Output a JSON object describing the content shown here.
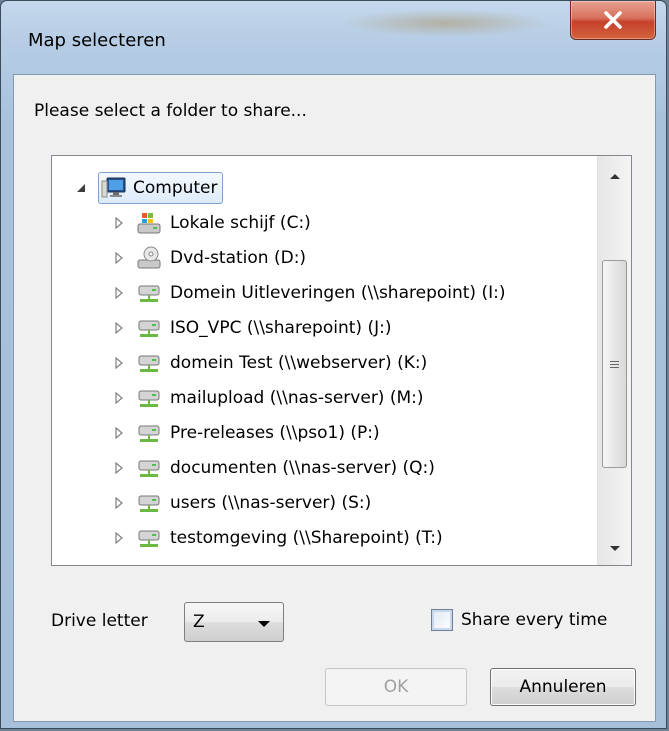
{
  "window": {
    "title": "Map selecteren",
    "close_icon": "close-icon"
  },
  "dialog": {
    "prompt": "Please select a folder to share...",
    "tree": {
      "root": {
        "label": "Computer",
        "icon": "computer-icon",
        "expanded": true
      },
      "children": [
        {
          "label": "Lokale schijf (C:)",
          "icon": "local-disk-icon"
        },
        {
          "label": "Dvd-station (D:)",
          "icon": "dvd-drive-icon"
        },
        {
          "label": "Domein Uitleveringen (\\\\sharepoint) (I:)",
          "icon": "network-drive-icon"
        },
        {
          "label": "ISO_VPC (\\\\sharepoint) (J:)",
          "icon": "network-drive-icon"
        },
        {
          "label": "domein Test (\\\\webserver) (K:)",
          "icon": "network-drive-icon"
        },
        {
          "label": "mailupload (\\\\nas-server) (M:)",
          "icon": "network-drive-icon"
        },
        {
          "label": "Pre-releases (\\\\pso1) (P:)",
          "icon": "network-drive-icon"
        },
        {
          "label": "documenten (\\\\nas-server) (Q:)",
          "icon": "network-drive-icon"
        },
        {
          "label": "users (\\\\nas-server) (S:)",
          "icon": "network-drive-icon"
        },
        {
          "label": "testomgeving (\\\\Sharepoint) (T:)",
          "icon": "network-drive-icon"
        }
      ]
    },
    "drive_letter": {
      "label": "Drive letter",
      "value": "Z"
    },
    "share_every_time": {
      "label": "Share every time",
      "checked": false
    },
    "buttons": {
      "ok": "OK",
      "cancel": "Annuleren"
    }
  },
  "colors": {
    "window_frame": "#a9c2dc",
    "close_button": "#c5402a",
    "selection_border": "#7da2ce"
  }
}
